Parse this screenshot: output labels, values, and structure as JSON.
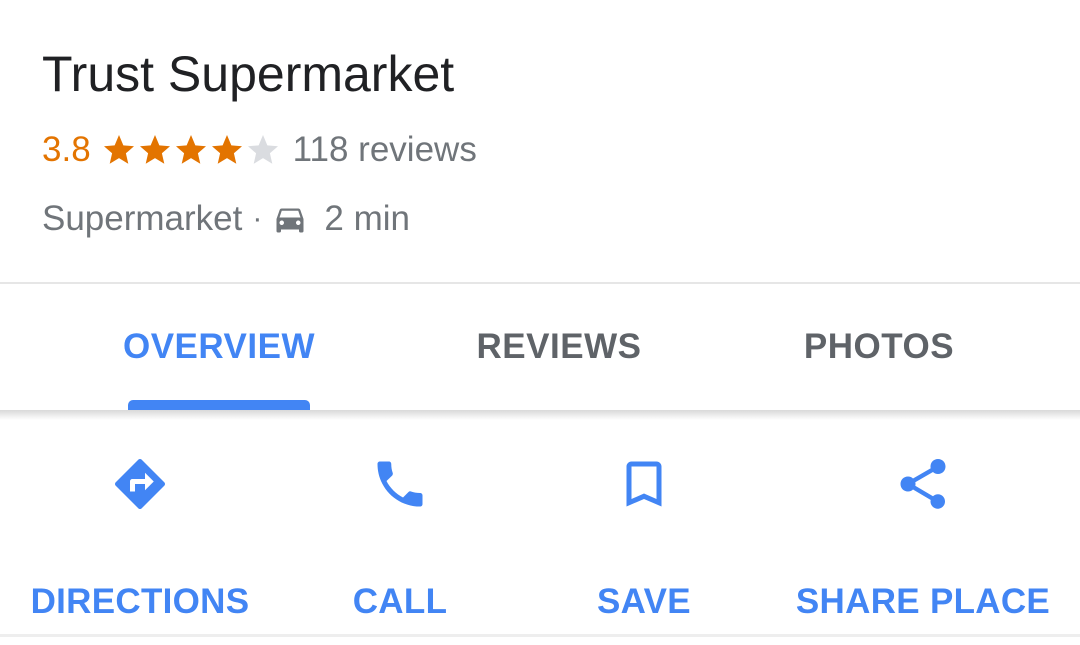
{
  "place": {
    "name": "Trust Supermarket",
    "rating": "3.8",
    "stars_filled": 4,
    "stars_total": 5,
    "reviews": "118 reviews",
    "category": "Supermarket",
    "separator": "·",
    "travel_mode_icon": "car-icon",
    "drive_time": "2 min"
  },
  "tabs": [
    {
      "label": "OVERVIEW",
      "active": true
    },
    {
      "label": "REVIEWS",
      "active": false
    },
    {
      "label": "PHOTOS",
      "active": false
    }
  ],
  "actions": [
    {
      "label": "DIRECTIONS",
      "icon": "directions-icon"
    },
    {
      "label": "CALL",
      "icon": "phone-icon"
    },
    {
      "label": "SAVE",
      "icon": "bookmark-icon"
    },
    {
      "label": "SHARE PLACE",
      "icon": "share-icon"
    }
  ],
  "colors": {
    "accent": "#4285f4",
    "rating": "#e37400",
    "star_empty": "#dadce0",
    "text_primary": "#202124",
    "text_secondary": "#70757a"
  }
}
